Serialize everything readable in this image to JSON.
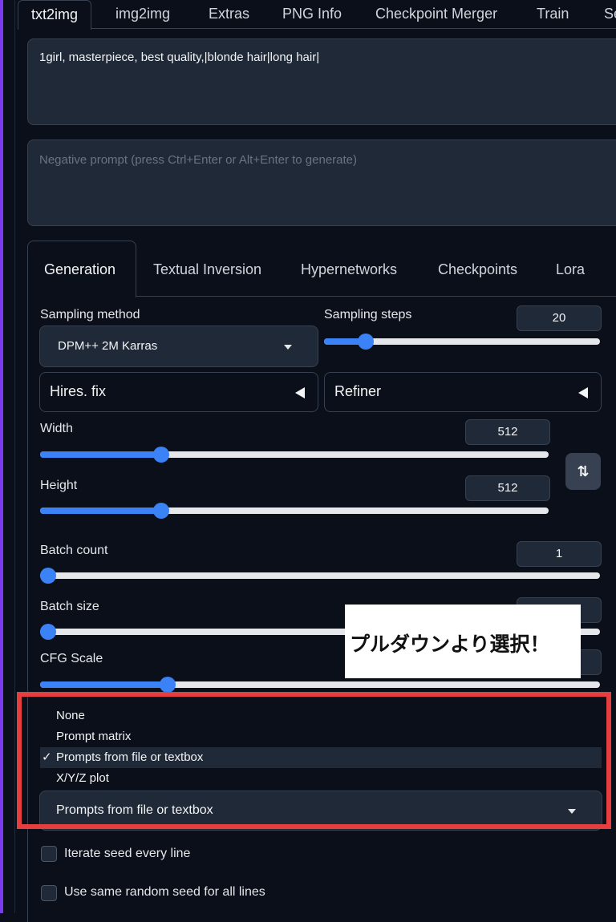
{
  "top_tabs": [
    "txt2img",
    "img2img",
    "Extras",
    "PNG Info",
    "Checkpoint Merger",
    "Train",
    "Se"
  ],
  "prompt": {
    "value": "1girl, masterpiece, best quality,|blonde hair|long hair|",
    "negative_placeholder": "Negative prompt (press Ctrl+Enter or Alt+Enter to generate)"
  },
  "sub_tabs": [
    "Generation",
    "Textual Inversion",
    "Hypernetworks",
    "Checkpoints",
    "Lora"
  ],
  "sampling": {
    "method_label": "Sampling method",
    "method_value": "DPM++ 2M Karras",
    "steps_label": "Sampling steps",
    "steps_value": "20",
    "steps_fraction": 0.13
  },
  "accordions": {
    "hires": "Hires. fix",
    "refiner": "Refiner"
  },
  "width": {
    "label": "Width",
    "value": "512",
    "fraction": 0.23
  },
  "height": {
    "label": "Height",
    "value": "512",
    "fraction": 0.23
  },
  "swap_icon": "⇅",
  "batch_count": {
    "label": "Batch count",
    "value": "1",
    "fraction": 0.0
  },
  "batch_size": {
    "label": "Batch size",
    "fraction": 0.0
  },
  "cfg": {
    "label": "CFG Scale",
    "fraction": 0.22
  },
  "overlay_text": "プルダウンより選択！",
  "script_dropdown": {
    "options": [
      "None",
      "Prompt matrix",
      "Prompts from file or textbox",
      "X/Y/Z plot"
    ],
    "checkmark": "✓",
    "selected": "Prompts from file or textbox"
  },
  "checkboxes": {
    "iterate_seed": "Iterate seed every line",
    "same_seed": "Use same random seed for all lines"
  },
  "colors": {
    "accent": "#3b82f6",
    "background": "#0b0f19",
    "highlight_frame": "#e53e3e"
  }
}
